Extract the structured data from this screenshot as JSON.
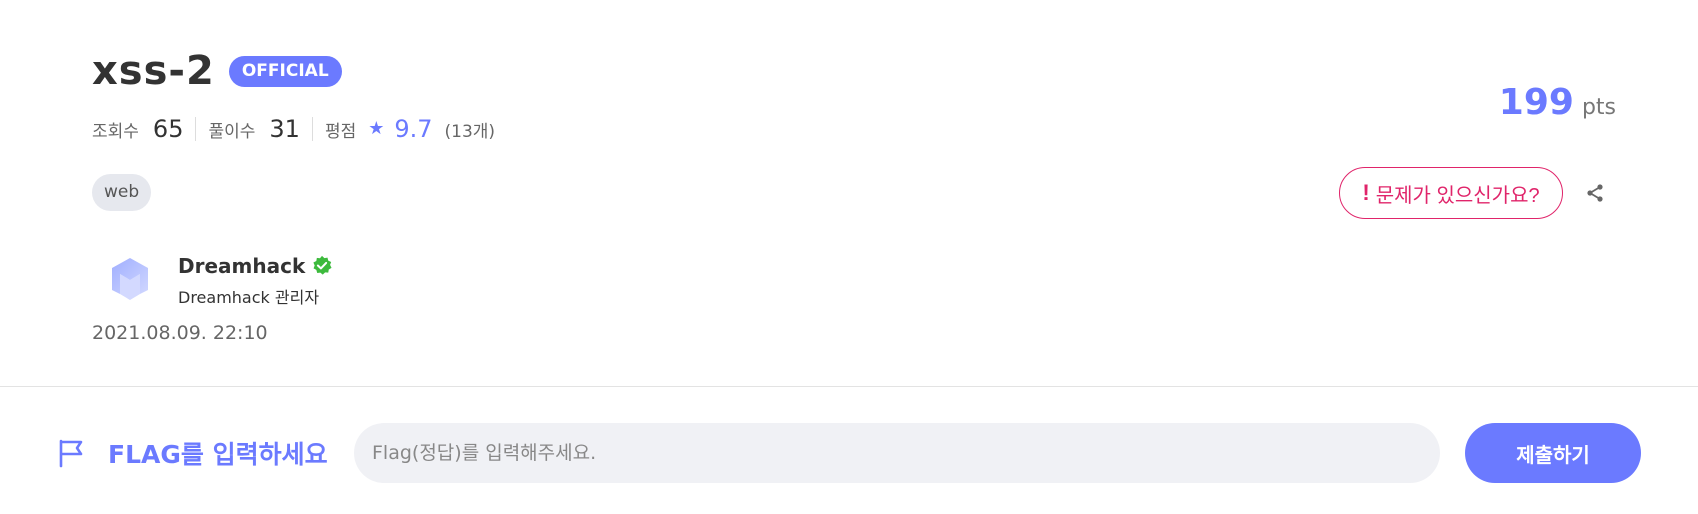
{
  "challenge": {
    "title": "xss-2",
    "badge": "OFFICIAL",
    "stats": {
      "views_label": "조회수",
      "views_value": "65",
      "solves_label": "풀이수",
      "solves_value": "31",
      "rating_label": "평점",
      "rating_value": "9.7",
      "rating_count": "(13개)"
    },
    "tag": "web",
    "author": {
      "name": "Dreamhack",
      "role": "Dreamhack 관리자",
      "avatar_icon": "dreamhack-logo-icon",
      "verified_icon": "verified-badge-icon"
    },
    "date": "2021.08.09. 22:10",
    "points": {
      "value": "199",
      "unit": "pts"
    },
    "report_label": "문제가 있으신가요?",
    "share_icon": "share-icon"
  },
  "flag_bar": {
    "label": "FLAG를 입력하세요",
    "input_placeholder": "Flag(정답)를 입력해주세요.",
    "input_value": "",
    "submit_label": "제출하기",
    "flag_icon": "flag-icon"
  },
  "colors": {
    "accent": "#6b7aff",
    "danger": "#e0246a",
    "verified": "#3dba3d",
    "tag_bg": "#e6e8ee",
    "input_bg": "#f0f1f5"
  }
}
